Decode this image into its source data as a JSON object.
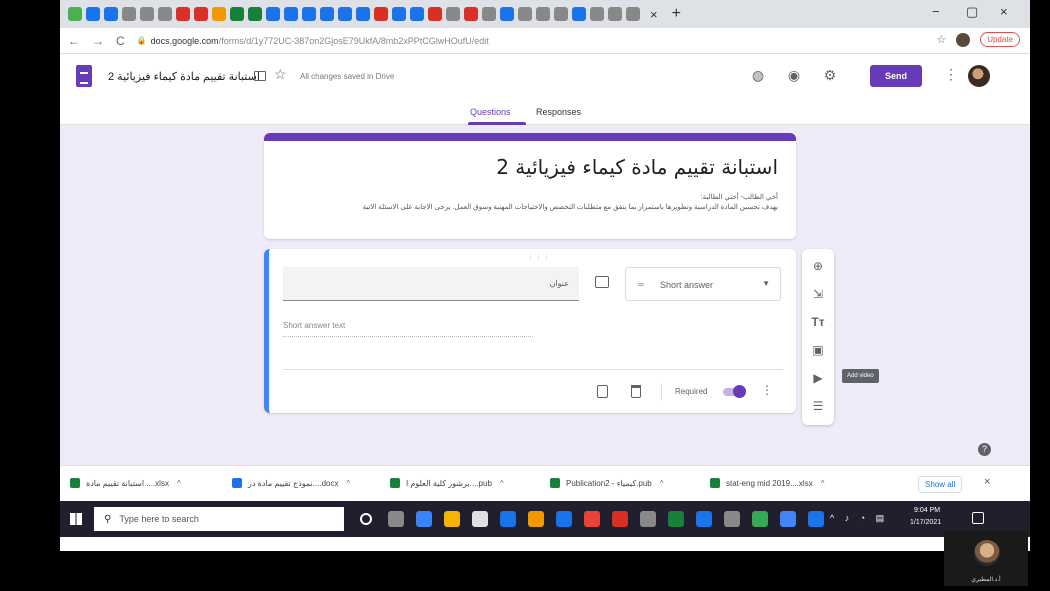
{
  "browser": {
    "tab_favicons": [
      "#4caf50",
      "#1a73e8",
      "#1a73e8",
      "#888",
      "#888",
      "#888",
      "#d93025",
      "#d93025",
      "#f29900",
      "#188038",
      "#188038",
      "#1a73e8",
      "#1a73e8",
      "#1a73e8",
      "#1a73e8",
      "#1a73e8",
      "#1a73e8",
      "#d93025",
      "#1a73e8",
      "#1a73e8",
      "#d93025",
      "#888",
      "#d93025",
      "#888",
      "#1a73e8",
      "#888",
      "#888",
      "#888",
      "#1a73e8",
      "#888",
      "#888",
      "#888"
    ],
    "tab_close": "×",
    "tab_new": "+",
    "window_minimize": "−",
    "window_maximize": "▢",
    "window_close": "×",
    "url_domain": "docs.google.com",
    "url_path": "/forms/d/1y772UC-387on2GjosE79UkfA/8mb2xPPtCGlwHOufU/edit",
    "update_label": "Update"
  },
  "form_header": {
    "doc_title": "استبانة تقييم مادة كيماء فيزيائية 2",
    "saved_status": "All changes saved in Drive",
    "send_label": "Send"
  },
  "tabs": {
    "questions": "Questions",
    "responses": "Responses"
  },
  "form": {
    "title": "استبانة تقييم مادة كيماء فيزيائية 2",
    "description_line1": "أخي الطالب- أختي الطالبة:",
    "description_line2": "يهدف تحسين المادة الدراسية وتطويرها باستمرار بما يتفق مع متطلبات التخصص والاحتياجات المهنية وسوق العمل. يرجى الاجابة على الاسئلة الاتية"
  },
  "question": {
    "title_text": "عنوان",
    "type_label": "Short answer",
    "answer_hint": "Short answer text",
    "required_label": "Required",
    "required_on": true
  },
  "toolbar": {
    "tooltip": "Add video"
  },
  "downloads": {
    "items": [
      "استبانة تقييم مادة ....xlsx",
      "نموذج تقييم مادة در....docx",
      "برشور كلية العلوم ا....pub",
      "Publication2 - كيمياء.pub",
      "stat-eng mid 2019....xlsx"
    ],
    "icon_colors": [
      "#188038",
      "#1a73e8",
      "#188038",
      "#188038",
      "#188038"
    ],
    "show_all": "Show all",
    "close": "×"
  },
  "taskbar": {
    "search_placeholder": "Type here to search",
    "clock_time": "9:04 PM",
    "clock_date": "1/17/2021",
    "app_colors": [
      "#ffffff",
      "#888888",
      "#3b82f6",
      "#f4b400",
      "#e0e0e0",
      "#1a73e8",
      "#f29900",
      "#1a73e8",
      "#ea4335",
      "#d93025",
      "#888888",
      "#188038",
      "#1a73e8",
      "#888888",
      "#34a853",
      "#4285f4",
      "#1a73e8"
    ]
  },
  "webcam": {
    "name": "أ.د.المطيري"
  }
}
